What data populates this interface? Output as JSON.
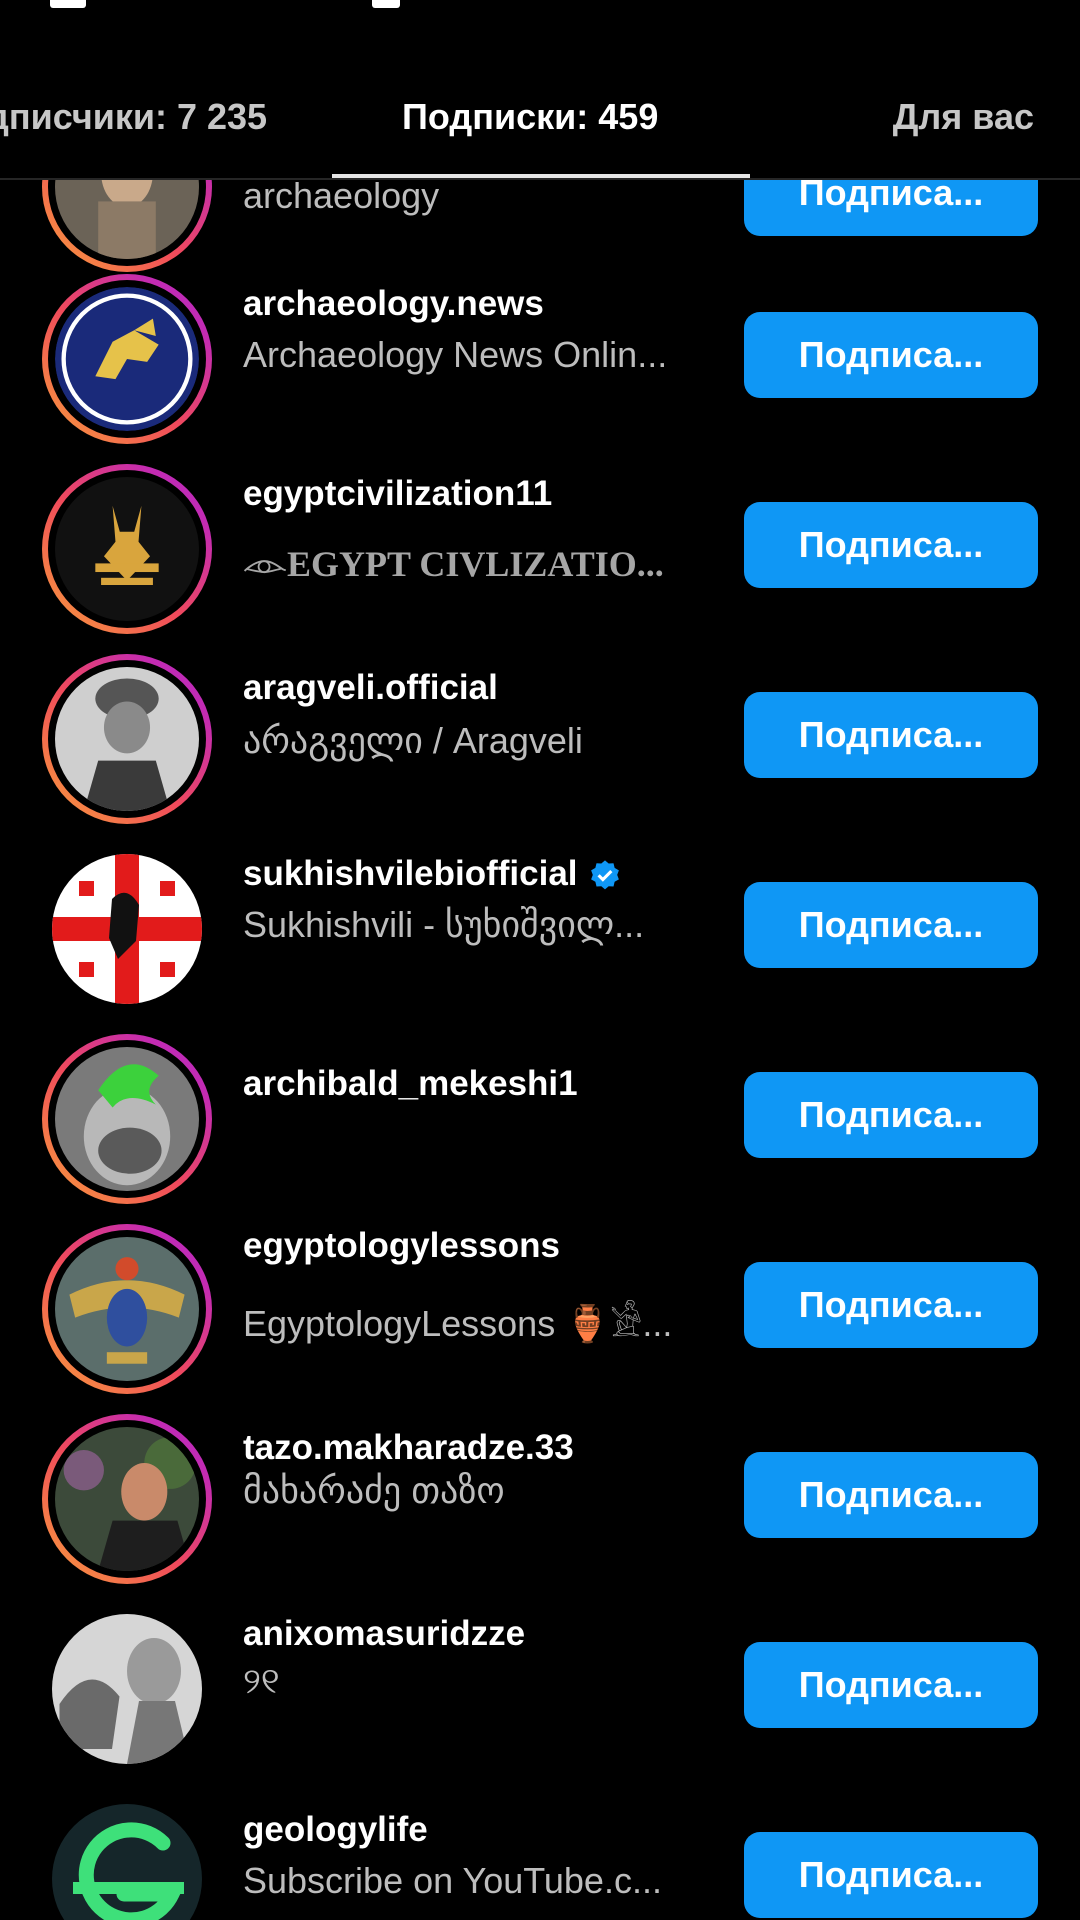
{
  "tabs": {
    "followers": "дписчики: 7 235",
    "following": "Подписки: 459",
    "for_you": "Для вас"
  },
  "button_label": "Подписа...",
  "rows": [
    {
      "username": "",
      "subtitle": "archaeology",
      "ring": true
    },
    {
      "username": "archaeology.news",
      "subtitle": "Archaeology News Onlin...",
      "ring": true
    },
    {
      "username": "egyptcivilization11",
      "subtitle": "𓁹EGYPT CIVLIZATIO...",
      "ring": true
    },
    {
      "username": "aragveli.official",
      "subtitle": "არაგველი / Aragveli",
      "ring": true
    },
    {
      "username": "sukhishvilebiofficial",
      "subtitle": "Sukhishvili - სუხიშვილ...",
      "ring": false,
      "verified": true
    },
    {
      "username": "archibald_mekeshi1",
      "subtitle": "",
      "ring": true
    },
    {
      "username": "egyptologylessons",
      "subtitle": "EgyptologyLessons 🏺𓀀...",
      "ring": true
    },
    {
      "username": "tazo.makharadze.33",
      "subtitle": "მახარაძე თაზო",
      "ring": true
    },
    {
      "username": "anixomasuridzze",
      "subtitle": "୨୧",
      "ring": false
    },
    {
      "username": "geologylife",
      "subtitle": "Subscribe on YouTube.c...",
      "ring": false
    }
  ],
  "colors": {
    "button": "#0f97f5",
    "background": "#000000",
    "verified": "#0f97f5"
  }
}
